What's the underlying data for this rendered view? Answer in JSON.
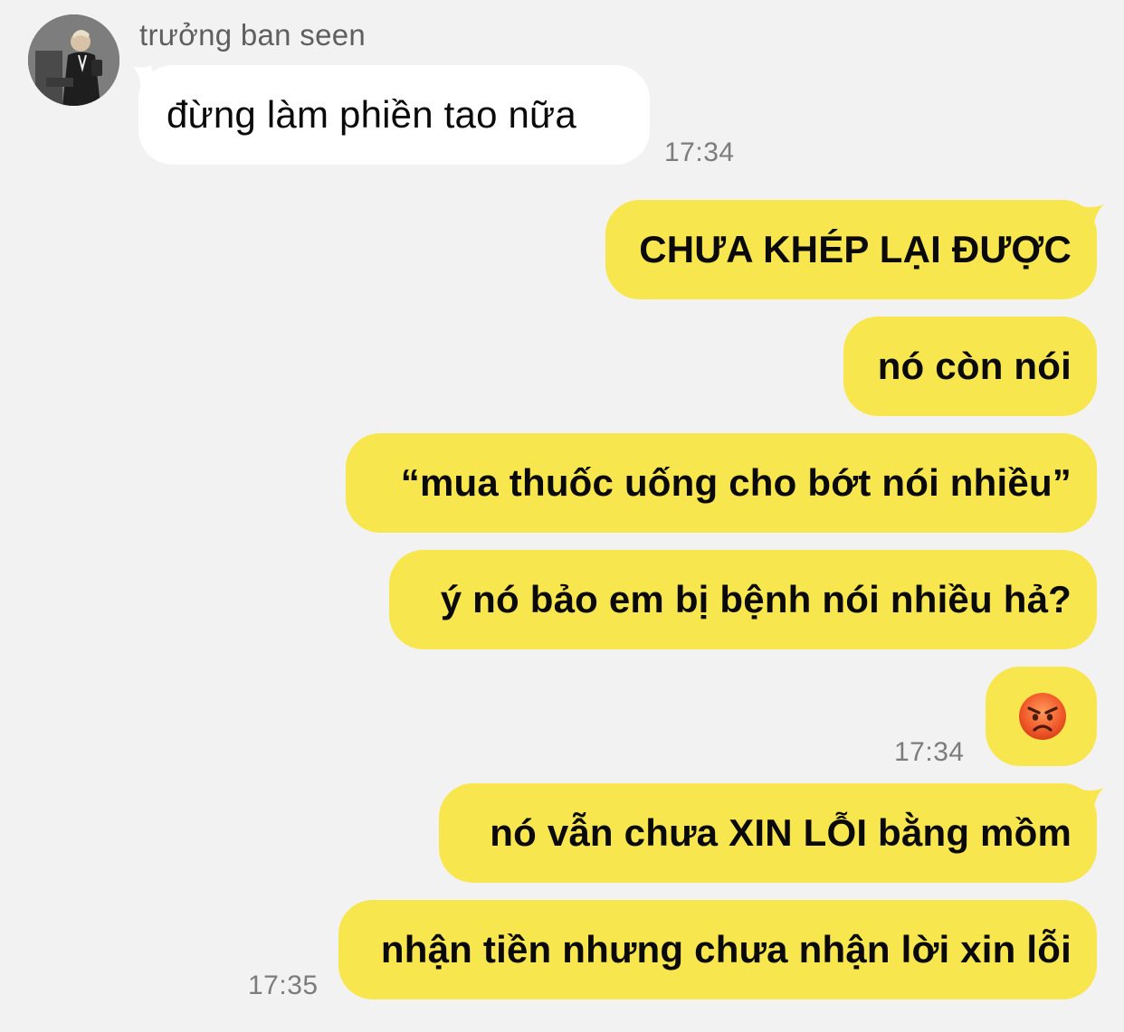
{
  "incoming": {
    "sender": "trưởng ban seen",
    "message": "đừng làm phiền tao nữa",
    "time": "17:34"
  },
  "outgoing": [
    {
      "text": "CHƯA KHÉP LẠI ĐƯỢC"
    },
    {
      "text": "nó còn nói"
    },
    {
      "text": "“mua thuốc uống cho bớt nói nhiều”"
    },
    {
      "text": "ý nó bảo em bị bệnh nói nhiều hả?"
    },
    {
      "emoji": "angry-face",
      "time": "17:34"
    },
    {
      "text": "nó vẫn chưa XIN LỖI bằng mồm"
    },
    {
      "text": "nhận tiền nhưng chưa nhận lời xin lỗi",
      "time": "17:35"
    }
  ],
  "colors": {
    "background": "#f2f2f2",
    "outgoing_bubble": "#f8e64e",
    "incoming_bubble": "#ffffff",
    "timestamp": "#7c7c7c"
  }
}
